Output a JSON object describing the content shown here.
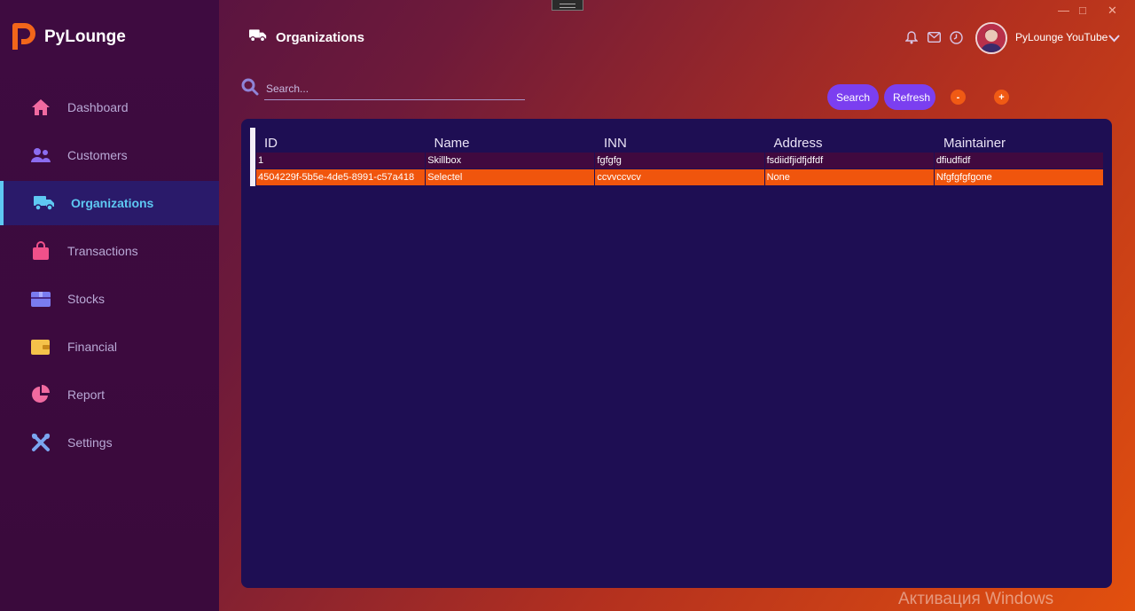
{
  "app": {
    "name": "PyLounge"
  },
  "sidebar": {
    "items": [
      {
        "label": "Dashboard",
        "icon": "home-icon",
        "color": "#f06aa0"
      },
      {
        "label": "Customers",
        "icon": "users-icon",
        "color": "#8b6cf0"
      },
      {
        "label": "Organizations",
        "icon": "truck-icon",
        "color": "#5ec8f2",
        "active": true
      },
      {
        "label": "Transactions",
        "icon": "shopping-bag-icon",
        "color": "#f0508a"
      },
      {
        "label": "Stocks",
        "icon": "box-icon",
        "color": "#7a7cf0"
      },
      {
        "label": "Financial",
        "icon": "wallet-icon",
        "color": "#f5c24a"
      },
      {
        "label": "Report",
        "icon": "pie-chart-icon",
        "color": "#f06aa0"
      },
      {
        "label": "Settings",
        "icon": "tools-icon",
        "color": "#7aa6f0"
      }
    ]
  },
  "header": {
    "title": "Organizations",
    "icons": [
      "bell-icon",
      "mail-icon",
      "clock-icon"
    ],
    "user_name": "PyLounge YouTube"
  },
  "search": {
    "placeholder": "Search...",
    "value": ""
  },
  "toolbar": {
    "search_label": "Search",
    "refresh_label": "Refresh",
    "remove_label": "-",
    "add_label": "+"
  },
  "table": {
    "columns": [
      "ID",
      "Name",
      "INN",
      "Address",
      "Maintainer"
    ],
    "rows": [
      [
        "1",
        "Skillbox",
        "fgfgfg",
        "fsdiidfjidfjdfdf",
        "dfiudfidf"
      ],
      [
        "4504229f-5b5e-4de5-8991-c57a418",
        "Selectel",
        "ccvvccvcv",
        "None",
        "Nfgfgfgfgone"
      ]
    ],
    "selected_row": 1
  },
  "watermark": "Активация Windows",
  "colors": {
    "accent_button": "#7b3ff0",
    "accent_orange": "#f05a14",
    "active_nav": "#5ec8f2",
    "panel": "#1e0e53",
    "sidebar": "#3e0b40"
  }
}
